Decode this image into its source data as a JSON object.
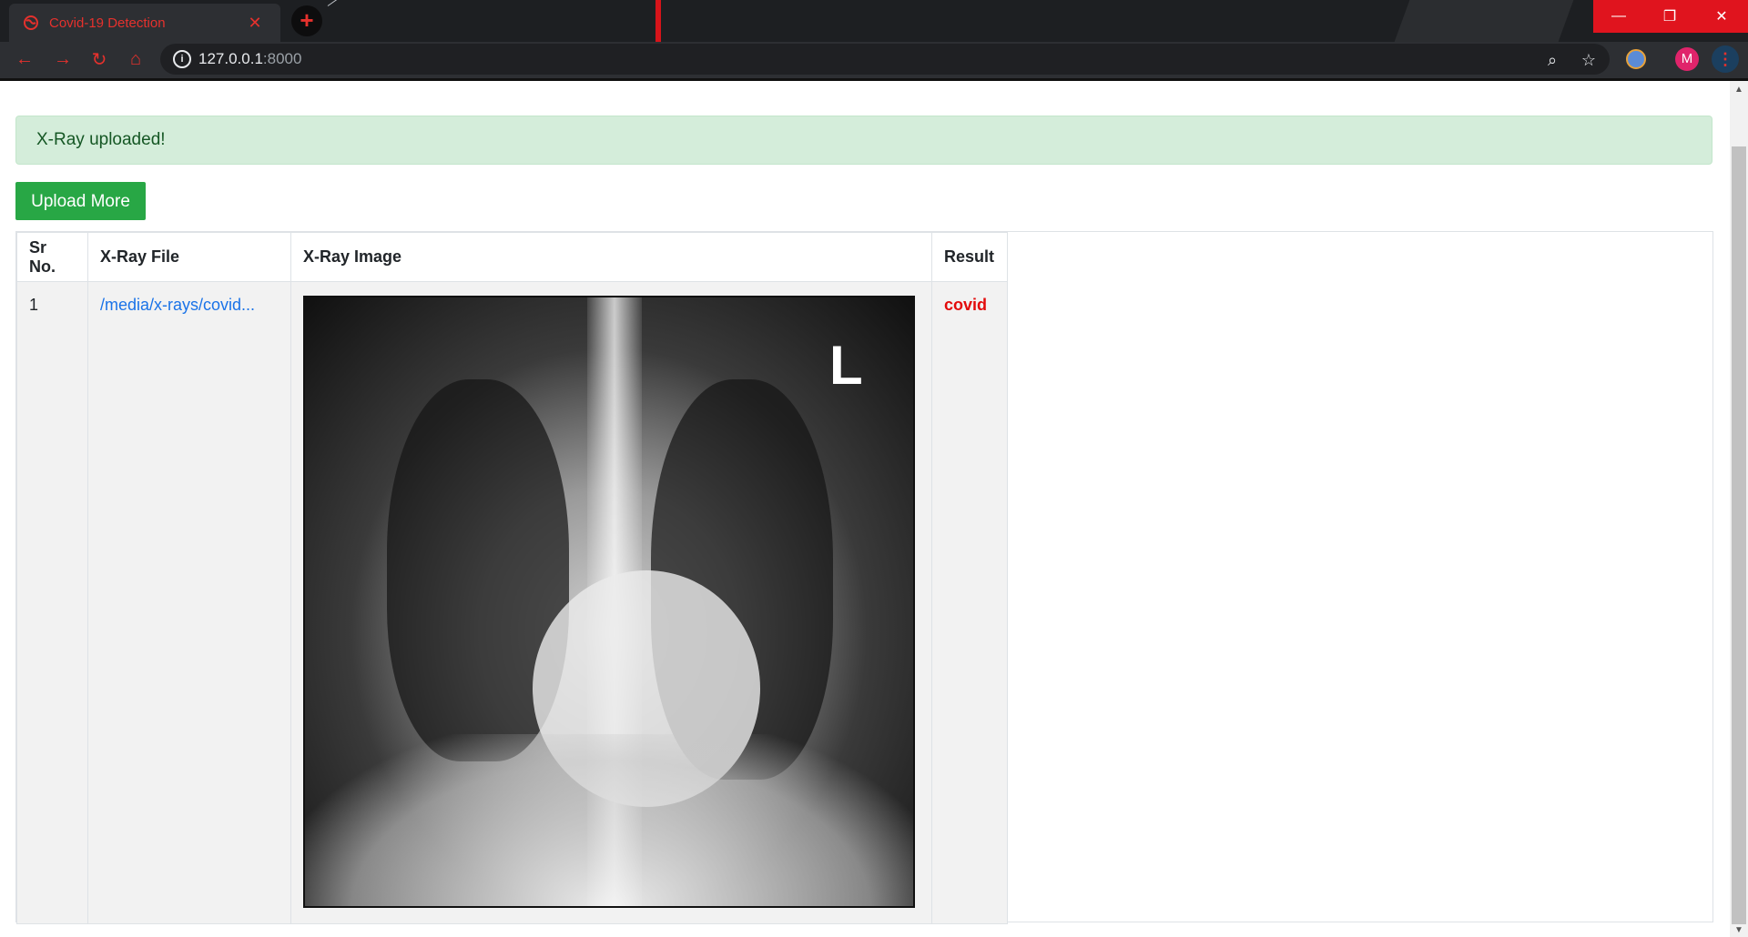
{
  "browser": {
    "tab_title": "Covid-19 Detection",
    "tab_close": "✕",
    "new_tab": "+",
    "url_host": "127.0.0.1",
    "url_port": ":8000",
    "avatar_letter": "M",
    "window_controls": {
      "minimize": "—",
      "maximize": "❐",
      "close": "✕"
    },
    "icons": [
      "back-icon",
      "forward-icon",
      "reload-icon",
      "home-icon",
      "site-info-icon",
      "zoom-icon",
      "bookmark-star-icon",
      "extension-icon",
      "menu-icon"
    ],
    "accent_color": "#e5312d"
  },
  "page": {
    "alert_message": "X-Ray uploaded!",
    "upload_button": "Upload More",
    "table": {
      "headers": [
        "Sr No.",
        "X-Ray File",
        "X-Ray Image",
        "Result"
      ],
      "rows": [
        {
          "sr": "1",
          "file": "/media/x-rays/covid...",
          "image_marker": "L",
          "result": "covid"
        }
      ]
    },
    "result_color": "#e30b0b",
    "alert_color": "#d4edda",
    "button_color": "#28a745"
  }
}
